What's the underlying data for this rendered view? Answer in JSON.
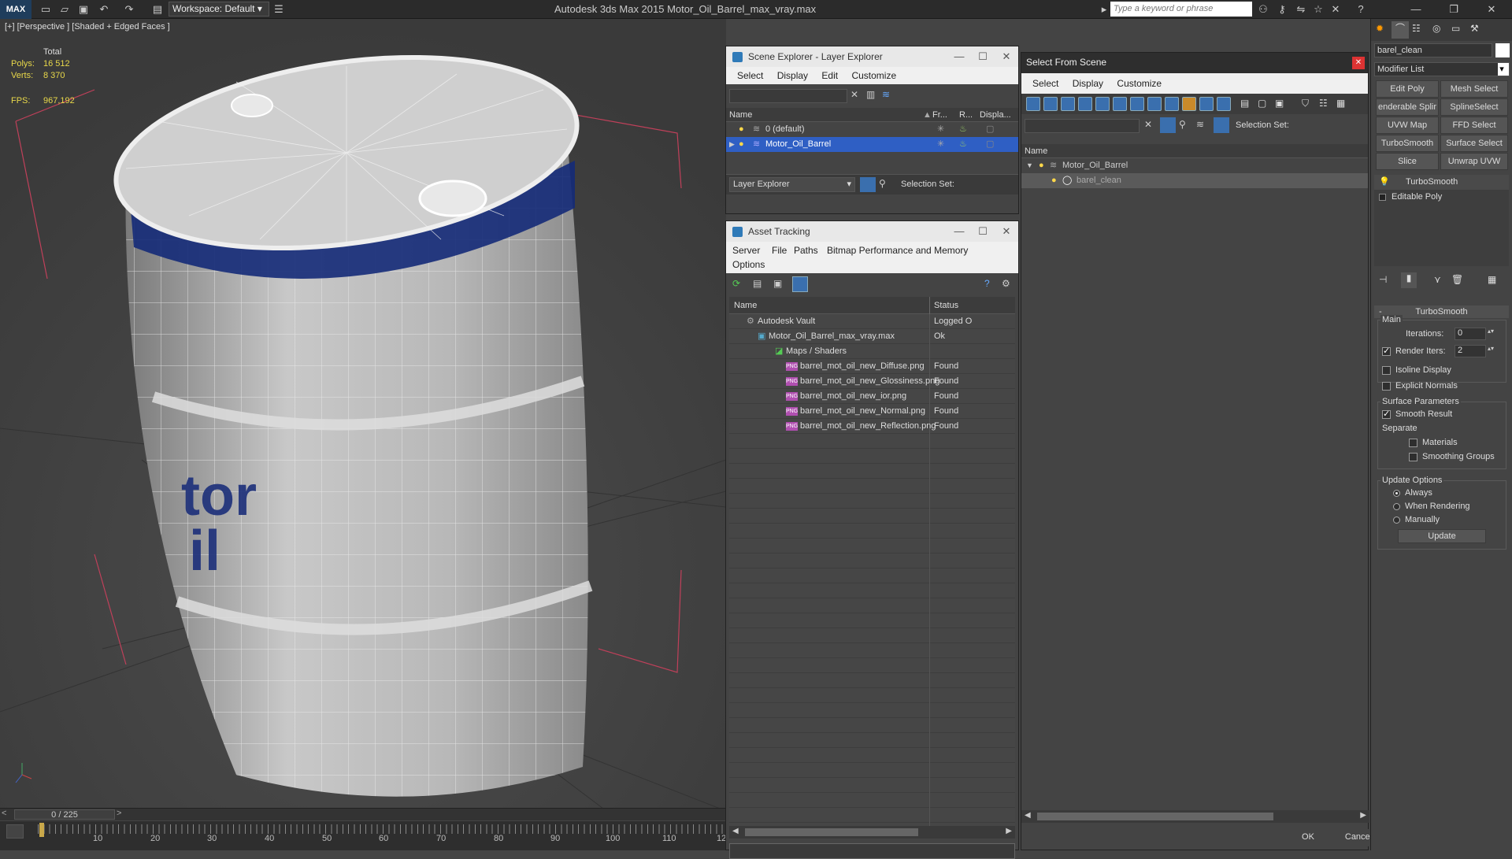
{
  "app": {
    "logo": "MAX",
    "workspace": "Workspace: Default",
    "title": "Autodesk 3ds Max  2015     Motor_Oil_Barrel_max_vray.max",
    "search_placeholder": "Type a keyword or phrase"
  },
  "viewport": {
    "label": "[+] [Perspective ] [Shaded + Edged Faces ]",
    "stats": {
      "total_label": "Total",
      "polys_label": "Polys:",
      "polys": "16 512",
      "verts_label": "Verts:",
      "verts": "8 370",
      "fps_label": "FPS:",
      "fps": "967,192"
    },
    "barrel_text": "tor\nil"
  },
  "timeline": {
    "frame": "0 / 225",
    "ticks": [
      "10",
      "20",
      "30",
      "40",
      "50",
      "60",
      "70",
      "80",
      "90",
      "100",
      "110",
      "12"
    ]
  },
  "scene_explorer": {
    "title": "Scene Explorer - Layer Explorer",
    "menu": [
      "Select",
      "Display",
      "Edit",
      "Customize"
    ],
    "columns": [
      "Name",
      "Fr...",
      "R...",
      "Displa..."
    ],
    "rows": [
      {
        "name": "0 (default)",
        "selected": false
      },
      {
        "name": "Motor_Oil_Barrel",
        "selected": true
      }
    ],
    "footer_dropdown": "Layer Explorer",
    "selection_set_label": "Selection Set:"
  },
  "asset_tracking": {
    "title": "Asset Tracking",
    "menu": [
      "Server",
      "File",
      "Paths",
      "Bitmap Performance and Memory",
      "Options"
    ],
    "columns": [
      "Name",
      "Status"
    ],
    "rows": [
      {
        "name": "Autodesk Vault",
        "status": "Logged O",
        "indent": 0,
        "icon": "vault"
      },
      {
        "name": "Motor_Oil_Barrel_max_vray.max",
        "status": "Ok",
        "indent": 1,
        "icon": "max"
      },
      {
        "name": "Maps / Shaders",
        "status": "",
        "indent": 2,
        "icon": "folder"
      },
      {
        "name": "barrel_mot_oil_new_Diffuse.png",
        "status": "Found",
        "indent": 3,
        "icon": "png"
      },
      {
        "name": "barrel_mot_oil_new_Glossiness.png",
        "status": "Found",
        "indent": 3,
        "icon": "png"
      },
      {
        "name": "barrel_mot_oil_new_ior.png",
        "status": "Found",
        "indent": 3,
        "icon": "png"
      },
      {
        "name": "barrel_mot_oil_new_Normal.png",
        "status": "Found",
        "indent": 3,
        "icon": "png"
      },
      {
        "name": "barrel_mot_oil_new_Reflection.png",
        "status": "Found",
        "indent": 3,
        "icon": "png"
      }
    ],
    "png_badge": "PNG"
  },
  "select_from_scene": {
    "title": "Select From Scene",
    "menu": [
      "Select",
      "Display",
      "Customize"
    ],
    "selection_set_label": "Selection Set:",
    "column": "Name",
    "rows": [
      {
        "name": "Motor_Oil_Barrel"
      },
      {
        "name": "barel_clean"
      }
    ],
    "ok": "OK",
    "cancel": "Cancel"
  },
  "command_panel": {
    "object_name": "barel_clean",
    "modifier_list": "Modifier List",
    "buttons": [
      "Edit Poly",
      "Mesh Select",
      "enderable Splir",
      "SplineSelect",
      "UVW Map",
      "FFD Select",
      "TurboSmooth",
      "Surface Select",
      "Slice",
      "Unwrap UVW"
    ],
    "stack": [
      "TurboSmooth",
      "Editable Poly"
    ],
    "rollout_title": "TurboSmooth",
    "main_label": "Main",
    "iterations_label": "Iterations:",
    "iterations": "0",
    "render_iters_label": "Render Iters:",
    "render_iters": "2",
    "isoline_label": "Isoline Display",
    "explicit_normals_label": "Explicit Normals",
    "surface_params_label": "Surface Parameters",
    "smooth_result_label": "Smooth Result",
    "separate_label": "Separate",
    "materials_label": "Materials",
    "smoothing_groups_label": "Smoothing Groups",
    "update_options_label": "Update Options",
    "always_label": "Always",
    "when_rendering_label": "When Rendering",
    "manually_label": "Manually",
    "update_button": "Update"
  },
  "colors": {
    "selection_blue": "#2f5fc4",
    "barrel_band": "#142a78",
    "bbox_red": "#c0405a"
  }
}
